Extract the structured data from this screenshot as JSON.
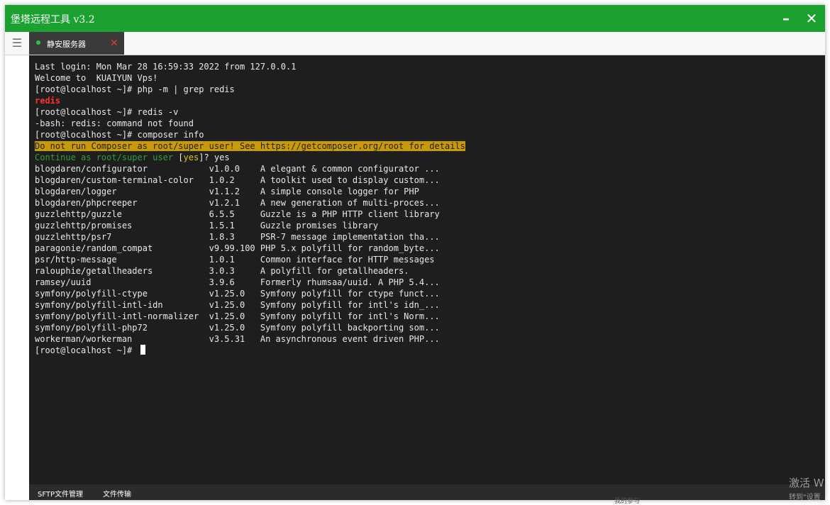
{
  "window": {
    "title": "堡塔远程工具 v3.2",
    "minimize_label": "–",
    "close_label": "✕"
  },
  "tabs": [
    {
      "label": "静安服务器",
      "status": "connected",
      "close_label": "✕"
    }
  ],
  "menu_icon_glyph": "☰",
  "terminal": {
    "lines": [
      "Last login: Mon Mar 28 16:59:33 2022 from 127.0.0.1",
      "Welcome to  KUAIYUN Vps!",
      "[root@localhost ~]# php -m | grep redis",
      "redis",
      "[root@localhost ~]# redis -v",
      "-bash: redis: command not found",
      "[root@localhost ~]# composer info",
      "Do not run Composer as root/super user! See https://getcomposer.org/root for details",
      "Continue as root/super user ",
      "blogdaren/configurator            v1.0.0    A elegant & common configurator ...",
      "blogdaren/custom-terminal-color   1.0.2     A toolkit used to display custom...",
      "blogdaren/logger                  v1.1.2    A simple console logger for PHP",
      "blogdaren/phpcreeper              v1.2.1    A new generation of multi-proces...",
      "guzzlehttp/guzzle                 6.5.5     Guzzle is a PHP HTTP client library",
      "guzzlehttp/promises               1.5.1     Guzzle promises library",
      "guzzlehttp/psr7                   1.8.3     PSR-7 message implementation tha...",
      "paragonie/random_compat           v9.99.100 PHP 5.x polyfill for random_byte...",
      "psr/http-message                  1.0.1     Common interface for HTTP messages",
      "ralouphie/getallheaders           3.0.3     A polyfill for getallheaders.",
      "ramsey/uuid                       3.9.6     Formerly rhumsaa/uuid. A PHP 5.4...",
      "symfony/polyfill-ctype            v1.25.0   Symfony polyfill for ctype funct...",
      "symfony/polyfill-intl-idn         v1.25.0   Symfony polyfill for intl's idn_...",
      "symfony/polyfill-intl-normalizer  v1.25.0   Symfony polyfill for intl's Norm...",
      "symfony/polyfill-php72            v1.25.0   Symfony polyfill backporting som...",
      "workerman/workerman               v3.5.31   An asynchronous event driven PHP...",
      "[root@localhost ~]# "
    ],
    "confirm_open": "[",
    "confirm_default": "yes",
    "confirm_close": "]? ",
    "confirm_answer": "yes"
  },
  "bottom_tabs": [
    {
      "label": "SFTP文件管理"
    },
    {
      "label": "文件传输"
    }
  ],
  "watermark": {
    "title": "激活 W",
    "subtitle": "转到\"设置"
  },
  "behind_text": "我的参与",
  "colors": {
    "titlebar": "#1aa130",
    "terminal_bg": "#1e1e1e",
    "terminal_fg": "#e8e8e8",
    "error_red": "#ff3030",
    "warning_bg": "#c89a06",
    "prompt_green": "#2fa03a",
    "prompt_yellow": "#e2c213",
    "status_dot": "#2ec43b"
  }
}
